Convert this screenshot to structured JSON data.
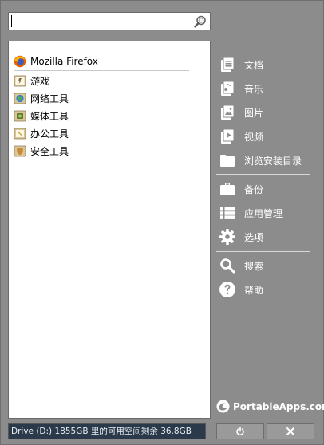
{
  "search": {
    "value": "",
    "placeholder": ""
  },
  "apps": [
    {
      "label": "Mozilla Firefox",
      "icon": "firefox-icon"
    },
    {
      "label": "游戏",
      "icon": "folder-icon"
    },
    {
      "label": "网络工具",
      "icon": "folder-icon"
    },
    {
      "label": "媒体工具",
      "icon": "folder-icon"
    },
    {
      "label": "办公工具",
      "icon": "folder-icon"
    },
    {
      "label": "安全工具",
      "icon": "folder-icon"
    }
  ],
  "menu": {
    "documents": "文档",
    "music": "音乐",
    "pictures": "图片",
    "videos": "视频",
    "explore": "浏览安装目录",
    "backup": "备份",
    "apps_manage": "应用管理",
    "options": "选项",
    "search": "搜索",
    "help": "帮助"
  },
  "brand": "PortableApps.com",
  "status": "Drive (D:) 1855GB 里的可用空间剩余 36.8GB",
  "colors": {
    "background": "#8c8c8c",
    "status_bg": "#2b3a4a",
    "firefox": "#e66000"
  }
}
